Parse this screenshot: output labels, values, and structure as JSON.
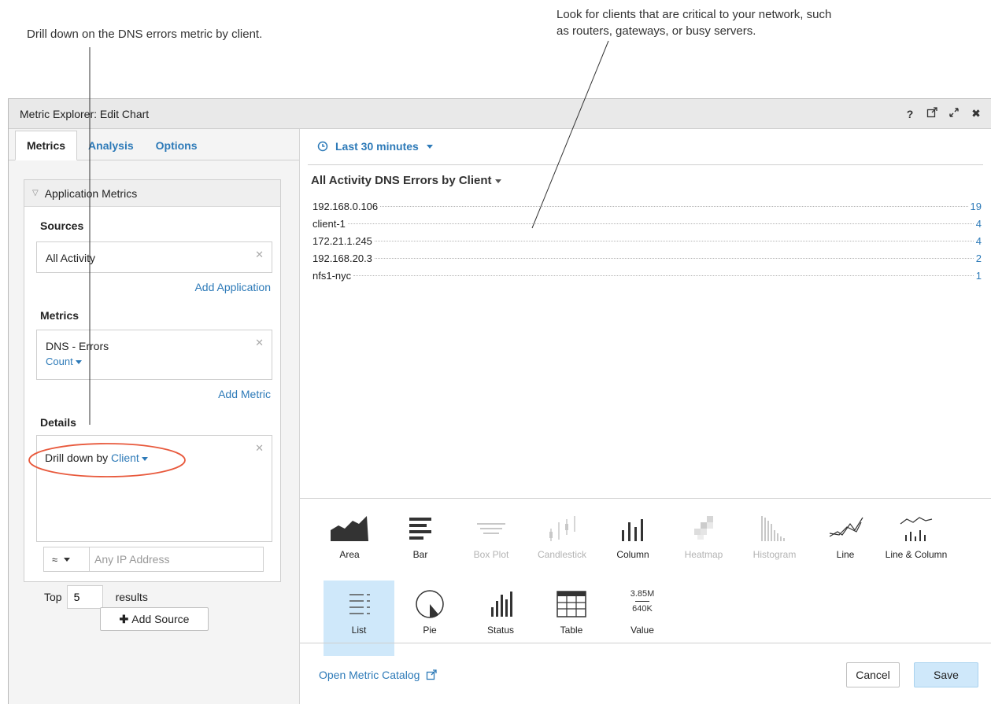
{
  "callouts": {
    "left": "Drill down on the DNS errors metric by client.",
    "right_line1": "Look for clients that are critical to your network, such",
    "right_line2": "as routers, gateways, or busy servers."
  },
  "dialog": {
    "title": "Metric Explorer: Edit Chart",
    "icons": [
      "help-icon",
      "external-link-icon",
      "expand-icon",
      "close-icon"
    ],
    "help_glyph": "?",
    "close_glyph": "✖"
  },
  "tabs": [
    "Metrics",
    "Analysis",
    "Options"
  ],
  "app_panel": {
    "header": "Application Metrics",
    "sources_label": "Sources",
    "source_value": "All Activity",
    "add_application": "Add Application",
    "metrics_label": "Metrics",
    "metric_value": "DNS - Errors",
    "metric_agg": "Count",
    "add_metric": "Add Metric",
    "details_label": "Details",
    "drill_prefix": "Drill down by",
    "drill_value": "Client",
    "ip_operator": "≈",
    "ip_placeholder": "Any IP Address",
    "top_label": "Top",
    "top_value": "5",
    "results_label": "results"
  },
  "add_source": "Add Source",
  "time_range": "Last 30 minutes",
  "chart": {
    "title": "All Activity DNS Errors by Client"
  },
  "chart_data": {
    "type": "table",
    "title": "All Activity DNS Errors by Client",
    "rows": [
      {
        "label": "192.168.0.106",
        "value": 19
      },
      {
        "label": "client-1",
        "value": 4
      },
      {
        "label": "172.21.1.245",
        "value": 4
      },
      {
        "label": "192.168.20.3",
        "value": 2
      },
      {
        "label": "nfs1-nyc",
        "value": 1
      }
    ]
  },
  "chart_types": [
    {
      "label": "Area",
      "icon": "area-chart-icon",
      "disabled": false
    },
    {
      "label": "Bar",
      "icon": "bar-chart-icon",
      "disabled": false
    },
    {
      "label": "Box Plot",
      "icon": "box-plot-icon",
      "disabled": true
    },
    {
      "label": "Candlestick",
      "icon": "candlestick-icon",
      "disabled": true
    },
    {
      "label": "Column",
      "icon": "column-chart-icon",
      "disabled": false
    },
    {
      "label": "Heatmap",
      "icon": "heatmap-icon",
      "disabled": true
    },
    {
      "label": "Histogram",
      "icon": "histogram-icon",
      "disabled": true
    },
    {
      "label": "Line",
      "icon": "line-chart-icon",
      "disabled": false
    },
    {
      "label": "Line & Column",
      "icon": "line-column-chart-icon",
      "disabled": false
    },
    {
      "label": "List",
      "icon": "list-chart-icon",
      "selected": true
    },
    {
      "label": "Pie",
      "icon": "pie-chart-icon"
    },
    {
      "label": "Status",
      "icon": "status-chart-icon"
    },
    {
      "label": "Table",
      "icon": "table-chart-icon"
    },
    {
      "label": "Value",
      "icon": "value-chart-icon",
      "value_top": "3.85M",
      "value_bottom": "640K"
    }
  ],
  "footer": {
    "catalog": "Open Metric Catalog",
    "cancel": "Cancel",
    "save": "Save"
  },
  "colors": {
    "link": "#2d7ab8",
    "selected_bg": "#cfe8fa",
    "highlight_ellipse": "#e8593c"
  }
}
